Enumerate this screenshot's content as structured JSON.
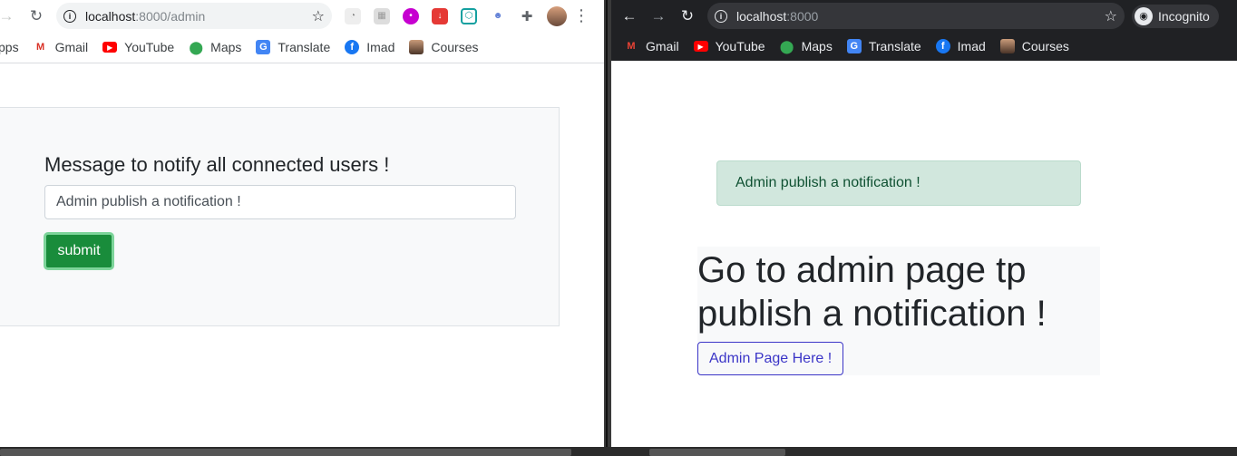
{
  "left": {
    "url_host": "localhost",
    "url_path": ":8000/admin",
    "bookmarks": [
      {
        "label": "pps",
        "icon": "apps-icon"
      },
      {
        "label": "Gmail",
        "icon": "gmail-icon"
      },
      {
        "label": "YouTube",
        "icon": "youtube-icon"
      },
      {
        "label": "Maps",
        "icon": "maps-icon"
      },
      {
        "label": "Translate",
        "icon": "translate-icon"
      },
      {
        "label": "Imad",
        "icon": "facebook-icon"
      },
      {
        "label": "Courses",
        "icon": "courses-icon"
      }
    ],
    "form": {
      "title": "Message to notify all connected users !",
      "input_value": "Admin publish a notification !",
      "submit_label": "submit"
    }
  },
  "right": {
    "url_host": "localhost",
    "url_path": ":8000",
    "incognito_label": "Incognito",
    "bookmarks": [
      {
        "label": "Gmail",
        "icon": "gmail-icon"
      },
      {
        "label": "YouTube",
        "icon": "youtube-icon"
      },
      {
        "label": "Maps",
        "icon": "maps-icon"
      },
      {
        "label": "Translate",
        "icon": "translate-icon"
      },
      {
        "label": "Imad",
        "icon": "facebook-icon"
      },
      {
        "label": "Courses",
        "icon": "courses-icon"
      }
    ],
    "alert_text": "Admin publish a notification !",
    "heading": "Go to admin page tp publish a notification !",
    "admin_link_label": "Admin Page Here !"
  },
  "colors": {
    "success_button": "#198c3b",
    "alert_bg": "#d1e7dd",
    "alert_text": "#0f5132",
    "link_primary": "#3b35c7",
    "dark_chrome": "#202124"
  }
}
